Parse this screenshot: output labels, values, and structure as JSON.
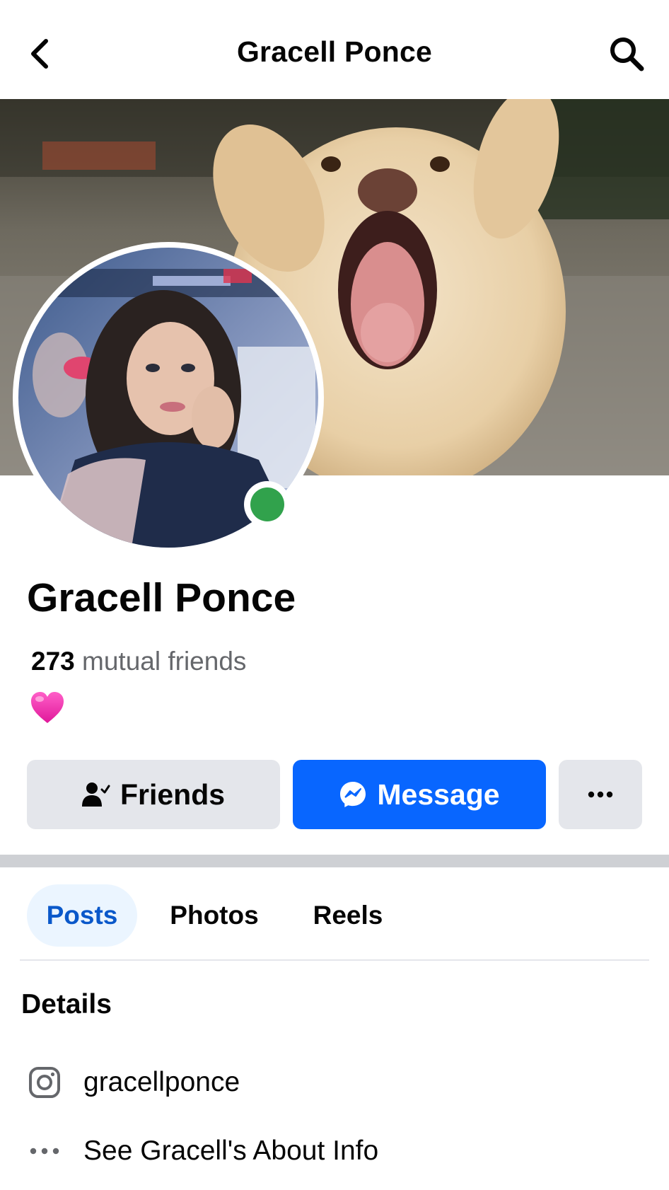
{
  "header": {
    "title": "Gracell Ponce",
    "back_icon": "chevron-left-icon",
    "search_icon": "search-icon"
  },
  "profile": {
    "name": "Gracell Ponce",
    "mutual_count": "273",
    "mutual_label": "mutual friends",
    "bio_emoji": "pink-heart",
    "online": true,
    "online_color": "#31a24c"
  },
  "actions": {
    "friends_label": "Friends",
    "message_label": "Message",
    "more_label": "more-options"
  },
  "tabs": [
    {
      "label": "Posts",
      "active": true
    },
    {
      "label": "Photos",
      "active": false
    },
    {
      "label": "Reels",
      "active": false
    }
  ],
  "details": {
    "title": "Details",
    "instagram": "gracellponce",
    "about_link": "See Gracell's About Info"
  },
  "colors": {
    "accent": "#0866ff",
    "tab_active_bg": "#ebf5ff",
    "tab_active_text": "#0a58ca",
    "button_gray": "#e4e6eb"
  }
}
